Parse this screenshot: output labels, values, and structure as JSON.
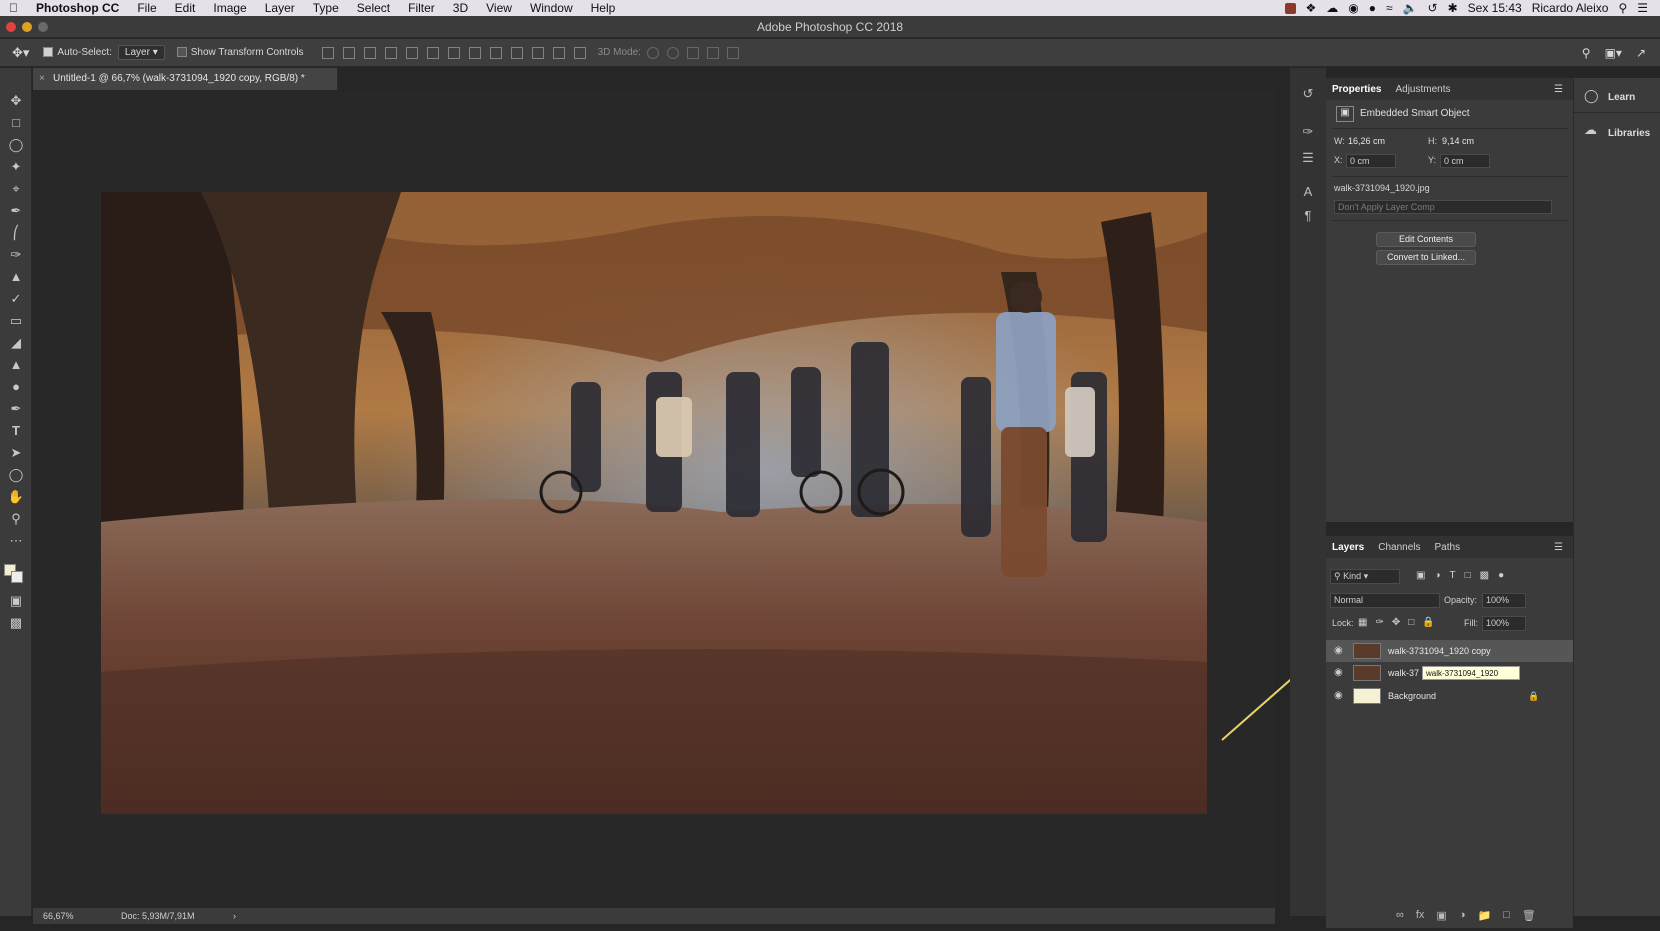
{
  "menubar": {
    "app": "Photoshop CC",
    "items": [
      "File",
      "Edit",
      "Image",
      "Layer",
      "Type",
      "Select",
      "Filter",
      "3D",
      "View",
      "Window",
      "Help"
    ],
    "clock": "Sex 15:43",
    "user": "Ricardo Aleixo"
  },
  "window": {
    "title": "Adobe Photoshop CC 2018"
  },
  "options": {
    "auto_select_label": "Auto-Select:",
    "auto_select_value": "Layer",
    "show_transform_label": "Show Transform Controls",
    "mode_label": "3D Mode:"
  },
  "document": {
    "tab_title": "Untitled-1 @ 66,7% (walk-3731094_1920 copy, RGB/8) *",
    "zoom": "66,67%",
    "doc_size": "Doc: 5,93M/7,91M"
  },
  "properties": {
    "tabs": [
      "Properties",
      "Adjustments"
    ],
    "object_type": "Embedded Smart Object",
    "w_label": "W:",
    "w_value": "16,26 cm",
    "h_label": "H:",
    "h_value": "9,14 cm",
    "x_label": "X:",
    "x_value": "0 cm",
    "y_label": "Y:",
    "y_value": "0 cm",
    "filename": "walk-3731094_1920.jpg",
    "layer_comp": "Don't Apply Layer Comp",
    "edit_contents": "Edit Contents",
    "convert_linked": "Convert to Linked..."
  },
  "right_panel": {
    "learn": "Learn",
    "libraries": "Libraries"
  },
  "layers": {
    "tabs": [
      "Layers",
      "Channels",
      "Paths"
    ],
    "filter_kind": "Kind",
    "blend_mode": "Normal",
    "opacity_label": "Opacity:",
    "opacity_value": "100%",
    "lock_label": "Lock:",
    "fill_label": "Fill:",
    "fill_value": "100%",
    "items": [
      {
        "name": "walk-3731094_1920 copy"
      },
      {
        "name": "walk-37"
      },
      {
        "name": "Background"
      }
    ],
    "tooltip": "walk-3731094_1920"
  },
  "colors": {
    "accent_arrow": "#e8d36a",
    "selected_row": "#565656"
  }
}
